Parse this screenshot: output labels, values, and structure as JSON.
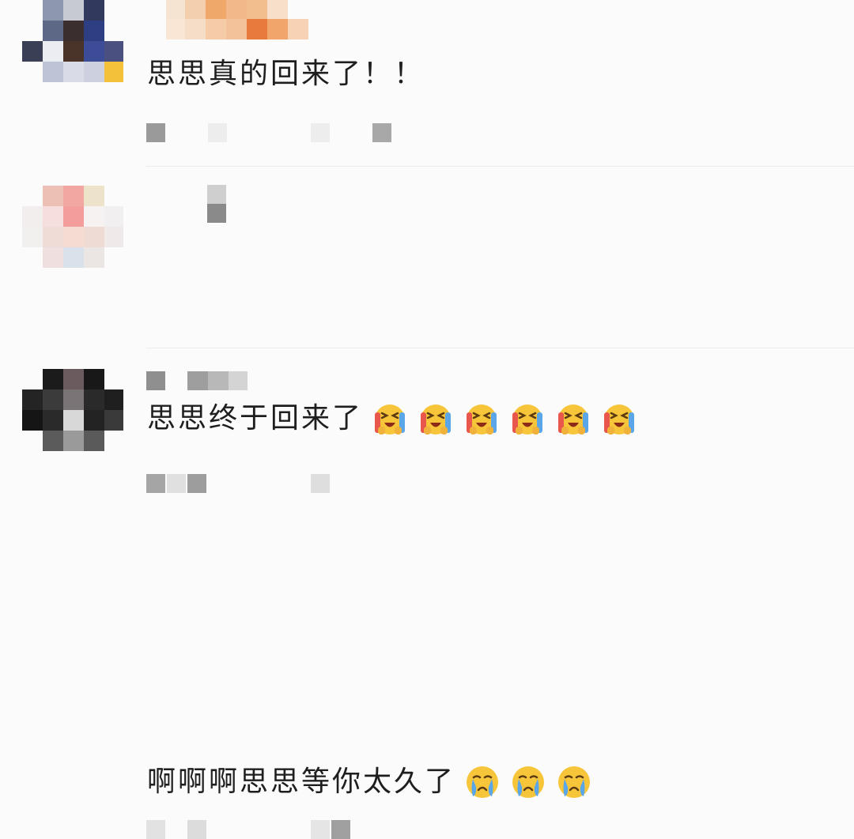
{
  "comments": [
    {
      "text": "思思真的回来了！！",
      "emojis": []
    },
    {
      "text": "思思终于回来了",
      "emojis": [
        "laugh-cry-emoji",
        "laugh-cry-emoji",
        "laugh-cry-emoji",
        "laugh-cry-emoji",
        "laugh-cry-emoji",
        "laugh-cry-emoji"
      ]
    },
    {
      "text": "啊啊啊思思等你太久了",
      "emojis": [
        "crying-emoji",
        "crying-emoji",
        "crying-emoji"
      ]
    }
  ],
  "colors": {
    "background": "#fbfbfb",
    "text": "#1e1e1e",
    "emoji_face": "#f7c53a",
    "emoji_tears": "#5aa6e8"
  }
}
